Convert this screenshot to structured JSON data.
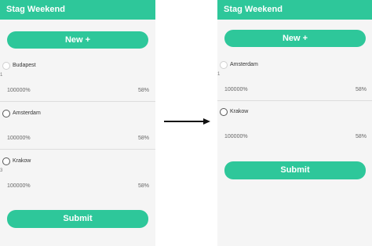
{
  "left_screen": {
    "title": "Stag Weekend",
    "new_button": "New +",
    "options": [
      {
        "name": "Budapest",
        "mark": "1",
        "left_value": "100000%",
        "right_value": "58%"
      },
      {
        "name": "Amsterdam",
        "mark": "",
        "left_value": "100000%",
        "right_value": "58%"
      },
      {
        "name": "Krakow",
        "mark": "3",
        "left_value": "100000%",
        "right_value": "58%"
      }
    ],
    "submit_button": "Submit"
  },
  "right_screen": {
    "title": "Stag Weekend",
    "new_button": "New +",
    "options": [
      {
        "name": "Amsterdam",
        "mark": "1",
        "left_value": "100000%",
        "right_value": "58%"
      },
      {
        "name": "Krakow",
        "mark": "",
        "left_value": "100000%",
        "right_value": "58%"
      }
    ],
    "submit_button": "Submit"
  },
  "colors": {
    "accent": "#2ec79a",
    "arrow": "#111111"
  },
  "icons": {
    "transition": "arrow-right-icon"
  }
}
